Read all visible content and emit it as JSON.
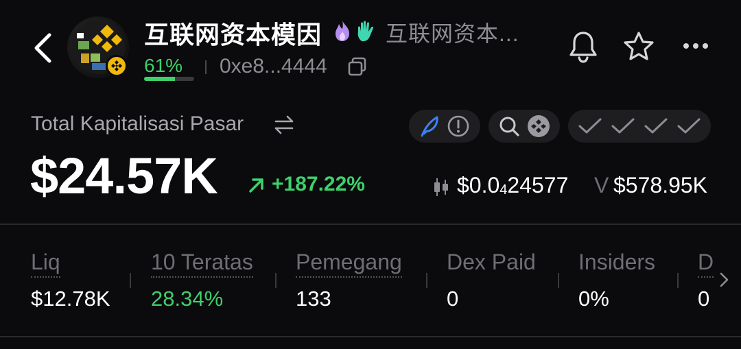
{
  "header": {
    "title": "互联网资本模因",
    "subtitle": "互联网资本...",
    "progress_text": "61%",
    "progress_value": 0.61,
    "address": "0xe8...4444"
  },
  "market": {
    "label": "Total Kapitalisasi Pasar",
    "value": "$24.57K",
    "change": "+187.22%",
    "price_prefix": "$0.0",
    "price_sub": "4",
    "price_rest": "24577",
    "volume_label": "V",
    "volume": "$578.95K"
  },
  "stats": [
    {
      "label": "Liq",
      "value": "$12.78K"
    },
    {
      "label": "10 Teratas",
      "value": "28.34%"
    },
    {
      "label": "Pemegang",
      "value": "133"
    },
    {
      "label": "Dex Paid",
      "value": "0"
    },
    {
      "label": "Insiders",
      "value": "0%"
    },
    {
      "label": "D",
      "value": "0"
    }
  ],
  "colors": {
    "background": "#0b0b0d",
    "positive": "#3fd06b",
    "muted": "#8d8d92",
    "chip": "#1e1e21",
    "accent_blue": "#3b82f6",
    "bnb": "#f0b90b"
  },
  "icons": [
    "back-arrow-icon",
    "bnb-chain-icon",
    "fire-icon",
    "hand-icon",
    "copy-icon",
    "bell-icon",
    "star-icon",
    "more-icon",
    "swap-icon",
    "feather-icon",
    "info-icon",
    "search-icon",
    "bscscan-icon",
    "check-icon",
    "candlestick-icon",
    "trend-up-icon",
    "chevron-right-icon"
  ]
}
